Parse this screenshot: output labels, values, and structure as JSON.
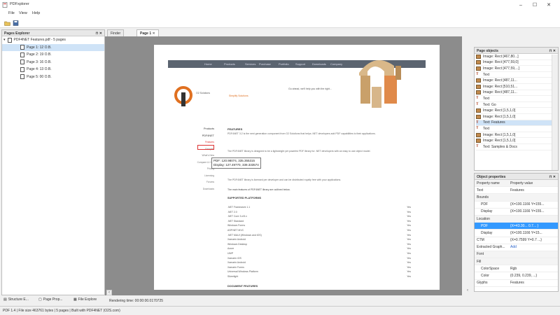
{
  "app": {
    "title": "PDFxplorer"
  },
  "menu": [
    "File",
    "View",
    "Help"
  ],
  "pages_explorer": {
    "title": "Pages Explorer",
    "root": "PDF4NET Features.pdf - 5 pages",
    "pages": [
      "Page 1: 12 O.B.",
      "Page 2: 19 O.B.",
      "Page 3: 16 O.B.",
      "Page 4: 13 O.B.",
      "Page 5: 00 O.B."
    ]
  },
  "tabs": {
    "tab1": "Finder",
    "tab2": "Page 1"
  },
  "page": {
    "nav": [
      "Home",
      "Products",
      "Services",
      "Purchase",
      "Portfolio",
      "Support",
      "Downloads",
      "Company"
    ],
    "company_name": "O2 Solutions",
    "slogan": "Simplify Solutions",
    "headline": "Go ahead, we'll help you with the right...",
    "left_menu": [
      "Products",
      "PDF4NET",
      "Features",
      "Samples",
      "What's New",
      "Compare & Cost",
      "Pricing",
      "Licensing",
      "Forums",
      "Downloads"
    ],
    "features_heading": "FEATURES",
    "paragraph1": "PDF4NET 3.2 is the next generation component from O2 Solutions that helps .NET developers add PDF capabilities to their applications.",
    "paragraph2": "The PDF4NET library is designed to be a lightweight yet powerful PDF library for .NET developers with an easy to use object model.",
    "paragraph3": "The PDF4NET library is licensed per developer and can be distributed royalty free with your applications.",
    "features_intro": "The main features of PDF4NET library are outlined below.",
    "supported_heading": "SUPPORTED PLATFORMS",
    "platforms": [
      ".NET Framework 1.1",
      ".NET 2.0",
      ".NET Core 3.x/5.x",
      ".NET Standard",
      "Windows Forms",
      "ASP.NET MVC",
      ".NET MAUI (Windows and iOS)",
      "Xamarin Android",
      "Windows Desktop",
      "Azure",
      "UWP",
      "Xamarin iOS",
      "Xamarin Android",
      "Xamarin Forms",
      "Universal Windows Platform",
      "Silverlight"
    ],
    "yes_label": "Yes",
    "document_heading": "DOCUMENT FEATURES",
    "tooltip_line1": "PDF: 120.98074, 335.355315",
    "tooltip_line2": "Display: 127.49770, 339.333574"
  },
  "page_objects": {
    "title": "Page objects",
    "items": [
      {
        "type": "image",
        "label": "Image: Rect [467,80...]"
      },
      {
        "type": "image",
        "label": "Image: Rect [477,59,0]"
      },
      {
        "type": "image",
        "label": "Image: Rect [477,59,...]"
      },
      {
        "type": "text",
        "label": "Text"
      },
      {
        "type": "image",
        "label": "Image: Rect [487,11..."
      },
      {
        "type": "image",
        "label": "Image: Rect [510,51..."
      },
      {
        "type": "image",
        "label": "Image: Rect [487,11..."
      },
      {
        "type": "text",
        "label": "Text"
      },
      {
        "type": "text",
        "label": "Text: Go"
      },
      {
        "type": "image",
        "label": "Image: Rect [1,5,1,0]"
      },
      {
        "type": "image",
        "label": "Image: Rect [1,5,1,0]"
      },
      {
        "type": "text",
        "label": "Text: Features"
      },
      {
        "type": "text",
        "label": "Text"
      },
      {
        "type": "image",
        "label": "Image: Rect [1,5,1,0]"
      },
      {
        "type": "image",
        "label": "Image: Rect [1,5,1,0]"
      },
      {
        "type": "text",
        "label": "Text: Samples & Docs"
      }
    ]
  },
  "object_properties": {
    "title": "Object properties",
    "col1": "Property name",
    "col2": "Property value",
    "rows": [
      {
        "name": "Text",
        "value": "Features",
        "indent": 0
      },
      {
        "name": "Bounds",
        "value": "",
        "indent": 0,
        "group": true
      },
      {
        "name": "PDF",
        "value": "{X=100.1166 Y=155...",
        "indent": 1
      },
      {
        "name": "Display",
        "value": "{X=100.1166 Y=155...",
        "indent": 1
      },
      {
        "name": "Location",
        "value": "",
        "indent": 0,
        "group": true
      },
      {
        "name": "PDF",
        "value": "{X=43.30... 0.7... }",
        "indent": 1,
        "sel": true
      },
      {
        "name": "Display",
        "value": "{X=100.1166 Y=15...",
        "indent": 1
      },
      {
        "name": "CTM",
        "value": "{X=0.7599 Y=0.7 ...}",
        "indent": 0
      },
      {
        "name": "Extracted Graph...",
        "value": "Add",
        "indent": 0
      },
      {
        "name": "Font",
        "value": "",
        "indent": 0,
        "group": true
      },
      {
        "name": "Fill",
        "value": "",
        "indent": 0,
        "group": true
      },
      {
        "name": "ColorSpace",
        "value": "Rgb",
        "indent": 1
      },
      {
        "name": "Color",
        "value": "{0.239, 0.239, ...}",
        "indent": 1
      },
      {
        "name": "Glyphs",
        "value": "Features",
        "indent": 0
      }
    ]
  },
  "bottom_tabs": [
    "Structure E...",
    "Page Prop...",
    "File Explore"
  ],
  "rendering_status": "Rendering time: 00:00:00.0170725",
  "statusbar": {
    "text": "PDF 1.4 | File size 463761 bytes | 5 pages | Built with PDF4NET (O2S.com)"
  }
}
